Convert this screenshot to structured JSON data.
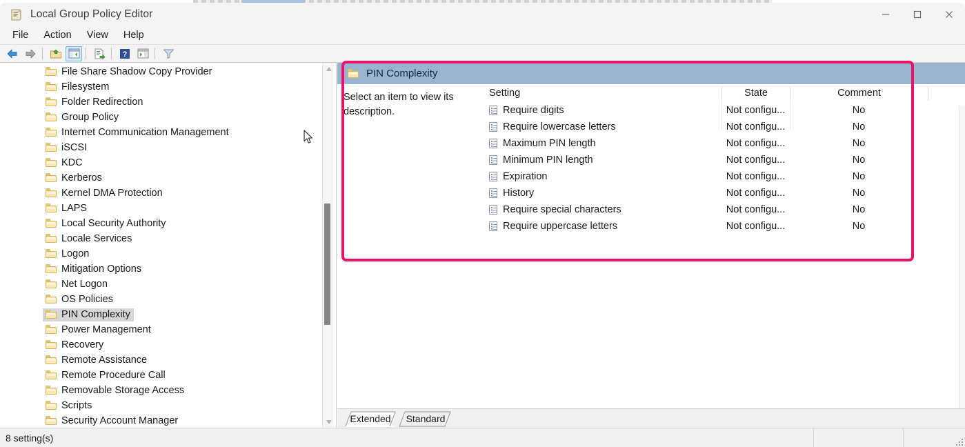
{
  "window": {
    "title": "Local Group Policy Editor",
    "icon": "policy-scroll-icon",
    "minimize": "—",
    "maximize": "☐",
    "close": "✕"
  },
  "menubar": {
    "items": [
      {
        "label": "File"
      },
      {
        "label": "Action"
      },
      {
        "label": "View"
      },
      {
        "label": "Help"
      }
    ]
  },
  "toolbar": {
    "buttons": [
      {
        "name": "back-icon"
      },
      {
        "name": "forward-icon"
      },
      {
        "name": "up-folder-icon"
      },
      {
        "name": "show-hide-console-tree-icon"
      },
      {
        "name": "export-list-icon"
      },
      {
        "name": "help-icon"
      },
      {
        "name": "show-hide-action-pane-icon"
      },
      {
        "name": "filter-icon"
      }
    ]
  },
  "tree": {
    "items": [
      {
        "label": "File Share Shadow Copy Provider",
        "expandable": false,
        "selected": false
      },
      {
        "label": "Filesystem",
        "expandable": true,
        "selected": false
      },
      {
        "label": "Folder Redirection",
        "expandable": false,
        "selected": false
      },
      {
        "label": "Group Policy",
        "expandable": false,
        "selected": false
      },
      {
        "label": "Internet Communication Management",
        "expandable": true,
        "selected": false
      },
      {
        "label": "iSCSI",
        "expandable": true,
        "selected": false
      },
      {
        "label": "KDC",
        "expandable": false,
        "selected": false
      },
      {
        "label": "Kerberos",
        "expandable": false,
        "selected": false
      },
      {
        "label": "Kernel DMA Protection",
        "expandable": false,
        "selected": false
      },
      {
        "label": "LAPS",
        "expandable": false,
        "selected": false
      },
      {
        "label": "Local Security Authority",
        "expandable": false,
        "selected": false
      },
      {
        "label": "Locale Services",
        "expandable": false,
        "selected": false
      },
      {
        "label": "Logon",
        "expandable": false,
        "selected": false
      },
      {
        "label": "Mitigation Options",
        "expandable": false,
        "selected": false
      },
      {
        "label": "Net Logon",
        "expandable": true,
        "selected": false
      },
      {
        "label": "OS Policies",
        "expandable": false,
        "selected": false
      },
      {
        "label": "PIN Complexity",
        "expandable": false,
        "selected": true
      },
      {
        "label": "Power Management",
        "expandable": true,
        "selected": false
      },
      {
        "label": "Recovery",
        "expandable": false,
        "selected": false
      },
      {
        "label": "Remote Assistance",
        "expandable": false,
        "selected": false
      },
      {
        "label": "Remote Procedure Call",
        "expandable": false,
        "selected": false
      },
      {
        "label": "Removable Storage Access",
        "expandable": false,
        "selected": false
      },
      {
        "label": "Scripts",
        "expandable": false,
        "selected": false
      },
      {
        "label": "Security Account Manager",
        "expandable": false,
        "selected": false
      }
    ]
  },
  "right_pane": {
    "header_title": "PIN Complexity",
    "header_icon": "folder-icon",
    "description": "Select an item to view its description.",
    "columns": [
      {
        "key": "setting",
        "label": "Setting"
      },
      {
        "key": "state",
        "label": "State"
      },
      {
        "key": "comment",
        "label": "Comment"
      }
    ],
    "rows": [
      {
        "setting": "Require digits",
        "state": "Not configu...",
        "comment": "No"
      },
      {
        "setting": "Require lowercase letters",
        "state": "Not configu...",
        "comment": "No"
      },
      {
        "setting": "Maximum PIN length",
        "state": "Not configu...",
        "comment": "No"
      },
      {
        "setting": "Minimum PIN length",
        "state": "Not configu...",
        "comment": "No"
      },
      {
        "setting": "Expiration",
        "state": "Not configu...",
        "comment": "No"
      },
      {
        "setting": "History",
        "state": "Not configu...",
        "comment": "No"
      },
      {
        "setting": "Require special characters",
        "state": "Not configu...",
        "comment": "No"
      },
      {
        "setting": "Require uppercase letters",
        "state": "Not configu...",
        "comment": "No"
      }
    ],
    "tabs": [
      {
        "label": "Extended",
        "selected": true
      },
      {
        "label": "Standard",
        "selected": false
      }
    ]
  },
  "statusbar": {
    "text": "8 setting(s)",
    "pane_a": "",
    "pane_b": "",
    "pane_c": ""
  },
  "annotation": {
    "highlight_color": "#e8146b"
  },
  "colors": {
    "header_blue": "#9ab4d0",
    "selection_gray": "#d6d6d6",
    "chrome_gray": "#f3f3f3"
  }
}
